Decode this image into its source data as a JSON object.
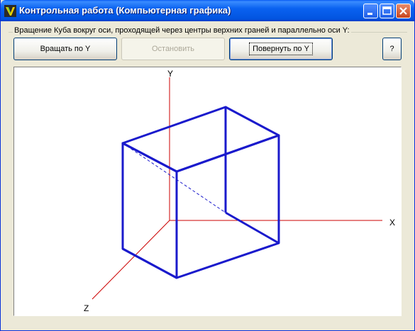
{
  "window": {
    "title": "Контрольная работа (Компьютерная графика)",
    "controls": {
      "minimize": "minimize-icon",
      "maximize": "maximize-icon",
      "close": "close-icon"
    }
  },
  "group": {
    "label": "Вращение Куба вокруг оси, проходящей через центры верхних граней и параллельно оси Y:"
  },
  "buttons": {
    "rotate": "Вращать по Y",
    "stop": "Остановить",
    "turn": "Повернуть по Y",
    "help": "?"
  },
  "axes": {
    "x": "X",
    "y": "Y",
    "z": "Z"
  },
  "colors": {
    "axis": "#cc0000",
    "cube": "#1a1acc",
    "titlebar": "#0a5df4"
  }
}
